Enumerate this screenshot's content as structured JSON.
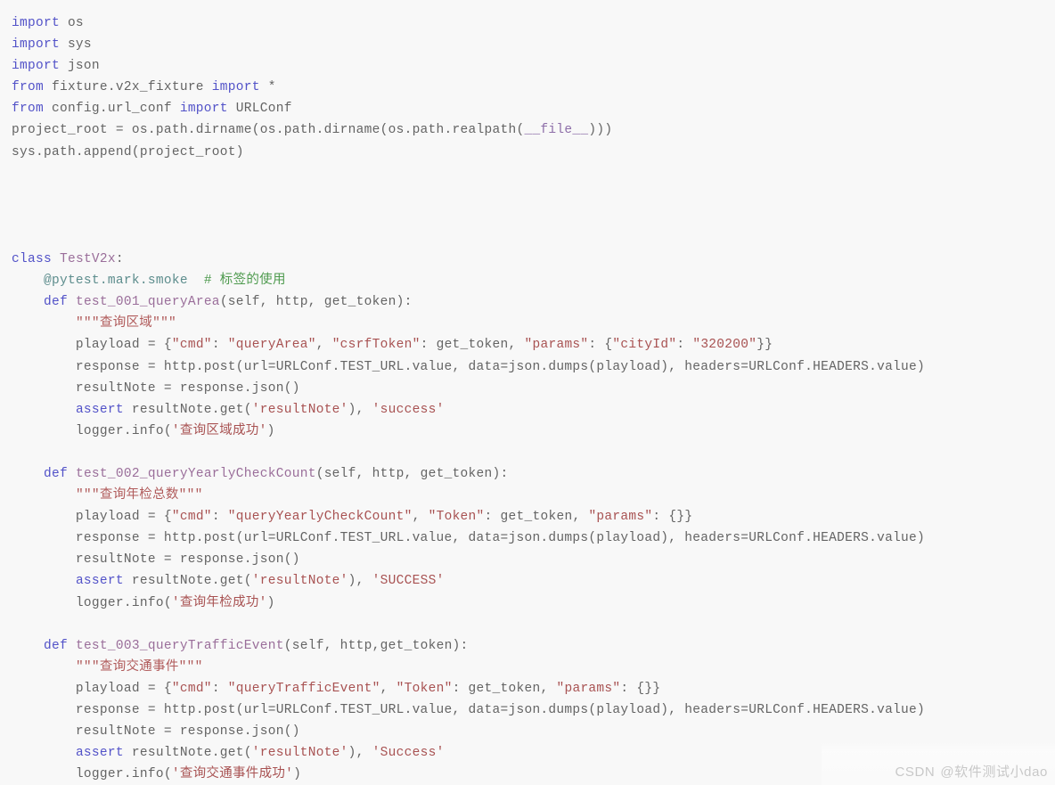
{
  "editor": {
    "language": "python",
    "background_color": "#f8f8f8",
    "default_text_color": "#646464",
    "colors": {
      "keyword": "#5252c8",
      "string": "#a85252",
      "docstring": "#b05a5a",
      "function_name": "#9a6e9a",
      "decorator": "#5d8d8d",
      "comment": "#4e9a4e",
      "dunder": "#8d6ea8"
    }
  },
  "code": {
    "lines": [
      {
        "n": 1,
        "tokens": [
          {
            "t": "import",
            "c": "kw"
          },
          {
            "t": " os",
            "c": "plain"
          }
        ]
      },
      {
        "n": 2,
        "tokens": [
          {
            "t": "import",
            "c": "kw"
          },
          {
            "t": " sys",
            "c": "plain"
          }
        ]
      },
      {
        "n": 3,
        "tokens": [
          {
            "t": "import",
            "c": "kw"
          },
          {
            "t": " json",
            "c": "plain"
          }
        ]
      },
      {
        "n": 4,
        "tokens": [
          {
            "t": "from",
            "c": "kw"
          },
          {
            "t": " fixture.v2x_fixture ",
            "c": "plain"
          },
          {
            "t": "import",
            "c": "kw"
          },
          {
            "t": " *",
            "c": "plain"
          }
        ]
      },
      {
        "n": 5,
        "tokens": [
          {
            "t": "from",
            "c": "kw"
          },
          {
            "t": " config.url_conf ",
            "c": "plain"
          },
          {
            "t": "import",
            "c": "kw"
          },
          {
            "t": " URLConf",
            "c": "plain"
          }
        ]
      },
      {
        "n": 6,
        "tokens": [
          {
            "t": "project_root = os.path.dirname(os.path.dirname(os.path.realpath(",
            "c": "plain"
          },
          {
            "t": "__file__",
            "c": "dunder"
          },
          {
            "t": ")))",
            "c": "plain"
          }
        ]
      },
      {
        "n": 7,
        "tokens": [
          {
            "t": "sys.path.append(project_root)",
            "c": "plain"
          }
        ]
      },
      {
        "n": 8,
        "tokens": []
      },
      {
        "n": 9,
        "tokens": []
      },
      {
        "n": 10,
        "tokens": []
      },
      {
        "n": 11,
        "tokens": []
      },
      {
        "n": 12,
        "tokens": [
          {
            "t": "class",
            "c": "kw"
          },
          {
            "t": " ",
            "c": "plain"
          },
          {
            "t": "TestV2x",
            "c": "fn"
          },
          {
            "t": ":",
            "c": "plain"
          }
        ]
      },
      {
        "n": 13,
        "tokens": [
          {
            "t": "    ",
            "c": "plain"
          },
          {
            "t": "@pytest.mark.smoke",
            "c": "deco"
          },
          {
            "t": "  ",
            "c": "plain"
          },
          {
            "t": "# 标签的使用",
            "c": "comment"
          }
        ]
      },
      {
        "n": 14,
        "tokens": [
          {
            "t": "    ",
            "c": "plain"
          },
          {
            "t": "def",
            "c": "kw"
          },
          {
            "t": " ",
            "c": "plain"
          },
          {
            "t": "test_001_queryArea",
            "c": "fn"
          },
          {
            "t": "(self, http, get_token):",
            "c": "plain"
          }
        ]
      },
      {
        "n": 15,
        "tokens": [
          {
            "t": "        ",
            "c": "plain"
          },
          {
            "t": "\"\"\"查询区域\"\"\"",
            "c": "doc"
          }
        ]
      },
      {
        "n": 16,
        "tokens": [
          {
            "t": "        playload = {",
            "c": "plain"
          },
          {
            "t": "\"cmd\"",
            "c": "str"
          },
          {
            "t": ": ",
            "c": "plain"
          },
          {
            "t": "\"queryArea\"",
            "c": "str"
          },
          {
            "t": ", ",
            "c": "plain"
          },
          {
            "t": "\"csrfToken\"",
            "c": "str"
          },
          {
            "t": ": get_token, ",
            "c": "plain"
          },
          {
            "t": "\"params\"",
            "c": "str"
          },
          {
            "t": ": {",
            "c": "plain"
          },
          {
            "t": "\"cityId\"",
            "c": "str"
          },
          {
            "t": ": ",
            "c": "plain"
          },
          {
            "t": "\"320200\"",
            "c": "str"
          },
          {
            "t": "}}",
            "c": "plain"
          }
        ]
      },
      {
        "n": 17,
        "tokens": [
          {
            "t": "        response = http.post(url=URLConf.TEST_URL.value, data=json.dumps(playload), headers=URLConf.HEADERS.value)",
            "c": "plain"
          }
        ]
      },
      {
        "n": 18,
        "tokens": [
          {
            "t": "        resultNote = response.json()",
            "c": "plain"
          }
        ]
      },
      {
        "n": 19,
        "tokens": [
          {
            "t": "        ",
            "c": "plain"
          },
          {
            "t": "assert",
            "c": "kw"
          },
          {
            "t": " resultNote.get(",
            "c": "plain"
          },
          {
            "t": "'resultNote'",
            "c": "str"
          },
          {
            "t": "), ",
            "c": "plain"
          },
          {
            "t": "'success'",
            "c": "str"
          }
        ]
      },
      {
        "n": 20,
        "tokens": [
          {
            "t": "        logger.info(",
            "c": "plain"
          },
          {
            "t": "'查询区域成功'",
            "c": "str"
          },
          {
            "t": ")",
            "c": "plain"
          }
        ]
      },
      {
        "n": 21,
        "tokens": []
      },
      {
        "n": 22,
        "tokens": [
          {
            "t": "    ",
            "c": "plain"
          },
          {
            "t": "def",
            "c": "kw"
          },
          {
            "t": " ",
            "c": "plain"
          },
          {
            "t": "test_002_queryYearlyCheckCount",
            "c": "fn"
          },
          {
            "t": "(self, http, get_token):",
            "c": "plain"
          }
        ]
      },
      {
        "n": 23,
        "tokens": [
          {
            "t": "        ",
            "c": "plain"
          },
          {
            "t": "\"\"\"查询年检总数\"\"\"",
            "c": "doc"
          }
        ]
      },
      {
        "n": 24,
        "tokens": [
          {
            "t": "        playload = {",
            "c": "plain"
          },
          {
            "t": "\"cmd\"",
            "c": "str"
          },
          {
            "t": ": ",
            "c": "plain"
          },
          {
            "t": "\"queryYearlyCheckCount\"",
            "c": "str"
          },
          {
            "t": ", ",
            "c": "plain"
          },
          {
            "t": "\"Token\"",
            "c": "str"
          },
          {
            "t": ": get_token, ",
            "c": "plain"
          },
          {
            "t": "\"params\"",
            "c": "str"
          },
          {
            "t": ": {}}",
            "c": "plain"
          }
        ]
      },
      {
        "n": 25,
        "tokens": [
          {
            "t": "        response = http.post(url=URLConf.TEST_URL.value, data=json.dumps(playload), headers=URLConf.HEADERS.value)",
            "c": "plain"
          }
        ]
      },
      {
        "n": 26,
        "tokens": [
          {
            "t": "        resultNote = response.json()",
            "c": "plain"
          }
        ]
      },
      {
        "n": 27,
        "tokens": [
          {
            "t": "        ",
            "c": "plain"
          },
          {
            "t": "assert",
            "c": "kw"
          },
          {
            "t": " resultNote.get(",
            "c": "plain"
          },
          {
            "t": "'resultNote'",
            "c": "str"
          },
          {
            "t": "), ",
            "c": "plain"
          },
          {
            "t": "'SUCCESS'",
            "c": "str"
          }
        ]
      },
      {
        "n": 28,
        "tokens": [
          {
            "t": "        logger.info(",
            "c": "plain"
          },
          {
            "t": "'查询年检成功'",
            "c": "str"
          },
          {
            "t": ")",
            "c": "plain"
          }
        ]
      },
      {
        "n": 29,
        "tokens": []
      },
      {
        "n": 30,
        "tokens": [
          {
            "t": "    ",
            "c": "plain"
          },
          {
            "t": "def",
            "c": "kw"
          },
          {
            "t": " ",
            "c": "plain"
          },
          {
            "t": "test_003_queryTrafficEvent",
            "c": "fn"
          },
          {
            "t": "(self, http,get_token):",
            "c": "plain"
          }
        ]
      },
      {
        "n": 31,
        "tokens": [
          {
            "t": "        ",
            "c": "plain"
          },
          {
            "t": "\"\"\"查询交通事件\"\"\"",
            "c": "doc"
          }
        ]
      },
      {
        "n": 32,
        "tokens": [
          {
            "t": "        playload = {",
            "c": "plain"
          },
          {
            "t": "\"cmd\"",
            "c": "str"
          },
          {
            "t": ": ",
            "c": "plain"
          },
          {
            "t": "\"queryTrafficEvent\"",
            "c": "str"
          },
          {
            "t": ", ",
            "c": "plain"
          },
          {
            "t": "\"Token\"",
            "c": "str"
          },
          {
            "t": ": get_token, ",
            "c": "plain"
          },
          {
            "t": "\"params\"",
            "c": "str"
          },
          {
            "t": ": {}}",
            "c": "plain"
          }
        ]
      },
      {
        "n": 33,
        "tokens": [
          {
            "t": "        response = http.post(url=URLConf.TEST_URL.value, data=json.dumps(playload), headers=URLConf.HEADERS.value)",
            "c": "plain"
          }
        ]
      },
      {
        "n": 34,
        "tokens": [
          {
            "t": "        resultNote = response.json()",
            "c": "plain"
          }
        ]
      },
      {
        "n": 35,
        "tokens": [
          {
            "t": "        ",
            "c": "plain"
          },
          {
            "t": "assert",
            "c": "kw"
          },
          {
            "t": " resultNote.get(",
            "c": "plain"
          },
          {
            "t": "'resultNote'",
            "c": "str"
          },
          {
            "t": "), ",
            "c": "plain"
          },
          {
            "t": "'Success'",
            "c": "str"
          }
        ]
      },
      {
        "n": 36,
        "tokens": [
          {
            "t": "        logger.info(",
            "c": "plain"
          },
          {
            "t": "'查询交通事件成功'",
            "c": "str"
          },
          {
            "t": ")",
            "c": "plain"
          }
        ]
      }
    ]
  },
  "watermark": {
    "brand": "CSDN",
    "user": "@软件测试小dao",
    "color": "#c8c8c8"
  }
}
